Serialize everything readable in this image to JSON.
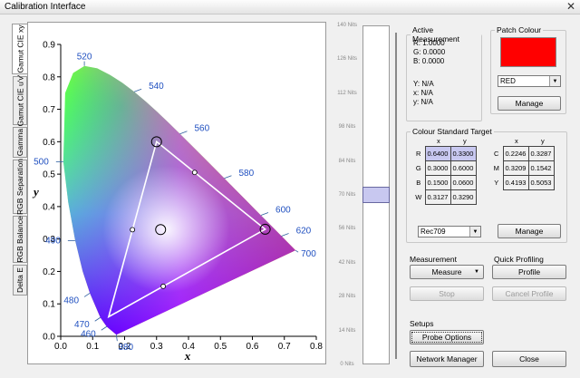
{
  "window": {
    "title": "Calibration Interface",
    "close_glyph": "✕"
  },
  "tabs": [
    "Gamut CIE xy",
    "Gamut CIE u'v'",
    "Gamma",
    "RGB Separation",
    "RGB Balance",
    "Delta E"
  ],
  "chart_data": {
    "type": "scatter",
    "title": "",
    "xlabel": "x",
    "ylabel": "y",
    "xlim": [
      0.0,
      0.8
    ],
    "ylim": [
      0.0,
      0.9
    ],
    "x_ticks": [
      "0.0",
      "0.1",
      "0.2",
      "0.3",
      "0.4",
      "0.5",
      "0.6",
      "0.7",
      "0.8"
    ],
    "y_ticks": [
      "0.0",
      "0.1",
      "0.2",
      "0.3",
      "0.4",
      "0.5",
      "0.6",
      "0.7",
      "0.8",
      "0.9"
    ],
    "wavelength_labels": [
      {
        "label": "380",
        "x": 0.174,
        "y": 0.005
      },
      {
        "label": "460",
        "x": 0.144,
        "y": 0.03
      },
      {
        "label": "470",
        "x": 0.124,
        "y": 0.058
      },
      {
        "label": "480",
        "x": 0.091,
        "y": 0.133
      },
      {
        "label": "490",
        "x": 0.045,
        "y": 0.295
      },
      {
        "label": "500",
        "x": 0.008,
        "y": 0.538
      },
      {
        "label": "520",
        "x": 0.074,
        "y": 0.834
      },
      {
        "label": "540",
        "x": 0.23,
        "y": 0.754
      },
      {
        "label": "560",
        "x": 0.373,
        "y": 0.624
      },
      {
        "label": "580",
        "x": 0.512,
        "y": 0.487
      },
      {
        "label": "600",
        "x": 0.627,
        "y": 0.373
      },
      {
        "label": "620",
        "x": 0.691,
        "y": 0.309
      },
      {
        "label": "700",
        "x": 0.735,
        "y": 0.265
      }
    ],
    "target_triangle": [
      [
        0.64,
        0.33
      ],
      [
        0.3,
        0.6
      ],
      [
        0.15,
        0.06
      ]
    ],
    "white_point": [
      0.3127,
      0.329
    ],
    "secondary_points": [
      [
        0.2246,
        0.3287
      ],
      [
        0.3209,
        0.1542
      ],
      [
        0.4193,
        0.5053
      ]
    ],
    "target_markers": [
      [
        0.64,
        0.33
      ],
      [
        0.3,
        0.6
      ],
      [
        0.3127,
        0.329
      ]
    ]
  },
  "nits_scale": [
    "140 Nits",
    "126 Nits",
    "112 Nits",
    "98 Nits",
    "84 Nits",
    "70 Nits",
    "56 Nits",
    "42 Nits",
    "28 Nits",
    "14 Nits",
    "0 Nits"
  ],
  "slider": {
    "level_nits": 70
  },
  "active_measurement": {
    "legend": "Active Measurement",
    "r": "R: 1.0000",
    "g": "G: 0.0000",
    "b": "B: 0.0000",
    "Y": "Y: N/A",
    "x": "x: N/A",
    "y": "y: N/A"
  },
  "patch_colour": {
    "legend": "Patch Colour",
    "swatch": "#ff0000",
    "select": "RED",
    "manage": "Manage"
  },
  "colour_standard": {
    "legend": "Colour Standard Target",
    "col_x": "x",
    "col_y": "y",
    "primaries": [
      {
        "name": "R",
        "x": "0.6400",
        "y": "0.3300"
      },
      {
        "name": "G",
        "x": "0.3000",
        "y": "0.6000"
      },
      {
        "name": "B",
        "x": "0.1500",
        "y": "0.0600"
      },
      {
        "name": "W",
        "x": "0.3127",
        "y": "0.3290"
      }
    ],
    "secondaries": [
      {
        "name": "C",
        "x": "0.2246",
        "y": "0.3287"
      },
      {
        "name": "M",
        "x": "0.3209",
        "y": "0.1542"
      },
      {
        "name": "Y",
        "x": "0.4193",
        "y": "0.5053"
      }
    ],
    "standard": "Rec709",
    "manage": "Manage"
  },
  "measurement": {
    "label": "Measurement",
    "measure": "Measure",
    "stop": "Stop"
  },
  "quick_profiling": {
    "label": "Quick Profiling",
    "profile": "Profile",
    "cancel": "Cancel Profile"
  },
  "setups": {
    "label": "Setups",
    "probe_options": "Probe Options"
  },
  "footer": {
    "network_manager": "Network Manager",
    "close": "Close"
  }
}
